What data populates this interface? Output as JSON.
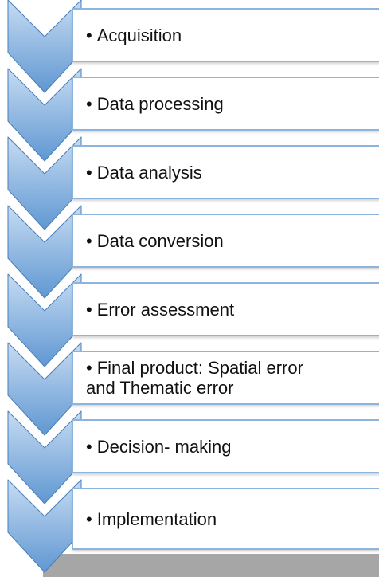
{
  "steps": [
    {
      "label": "Acquisition"
    },
    {
      "label": "Data processing"
    },
    {
      "label": "Data analysis"
    },
    {
      "label": "Data conversion"
    },
    {
      "label": "Error assessment"
    },
    {
      "label": "Final product: Spatial error",
      "label_line2": "and Thematic error"
    },
    {
      "label": "Decision- making"
    },
    {
      "label": "Implementation"
    }
  ],
  "bullet": "•",
  "colors": {
    "chevron_top": "#c7dcf2",
    "chevron_bottom": "#5f97d2",
    "chevron_stroke": "#4a7fb9",
    "box_border": "#8cb4de",
    "bottom_bar": "#a6a6a6",
    "text": "#111111"
  }
}
